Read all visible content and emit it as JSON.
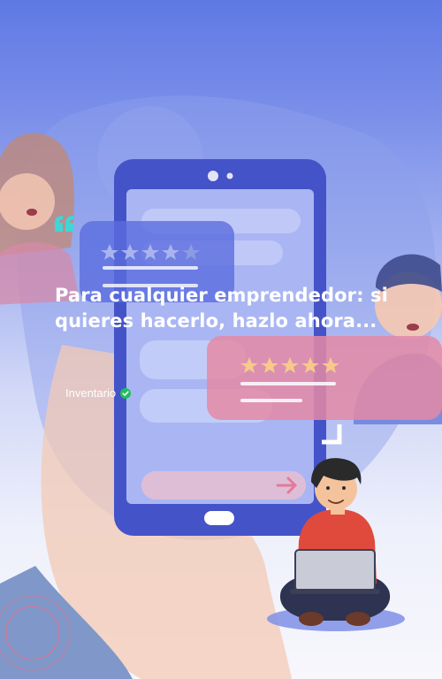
{
  "testimonial": {
    "quote": "Para cualquier emprendedor: si quieres hacerlo, hazlo ahora...",
    "author": "Inventario",
    "verified": true
  },
  "icons": {
    "quote": "quote-icon",
    "verified": "verified-check-icon",
    "corner": "corner-bracket-icon"
  },
  "colors": {
    "gradient_top": "#5f79e4",
    "gradient_bottom": "#f7f7fc",
    "accent_green": "#1fbf5c",
    "quote_cyan": "#3fd6d6",
    "headline": "#ffffff"
  },
  "illustration": {
    "review_card_left_stars": 5,
    "review_card_right_stars": 5
  }
}
